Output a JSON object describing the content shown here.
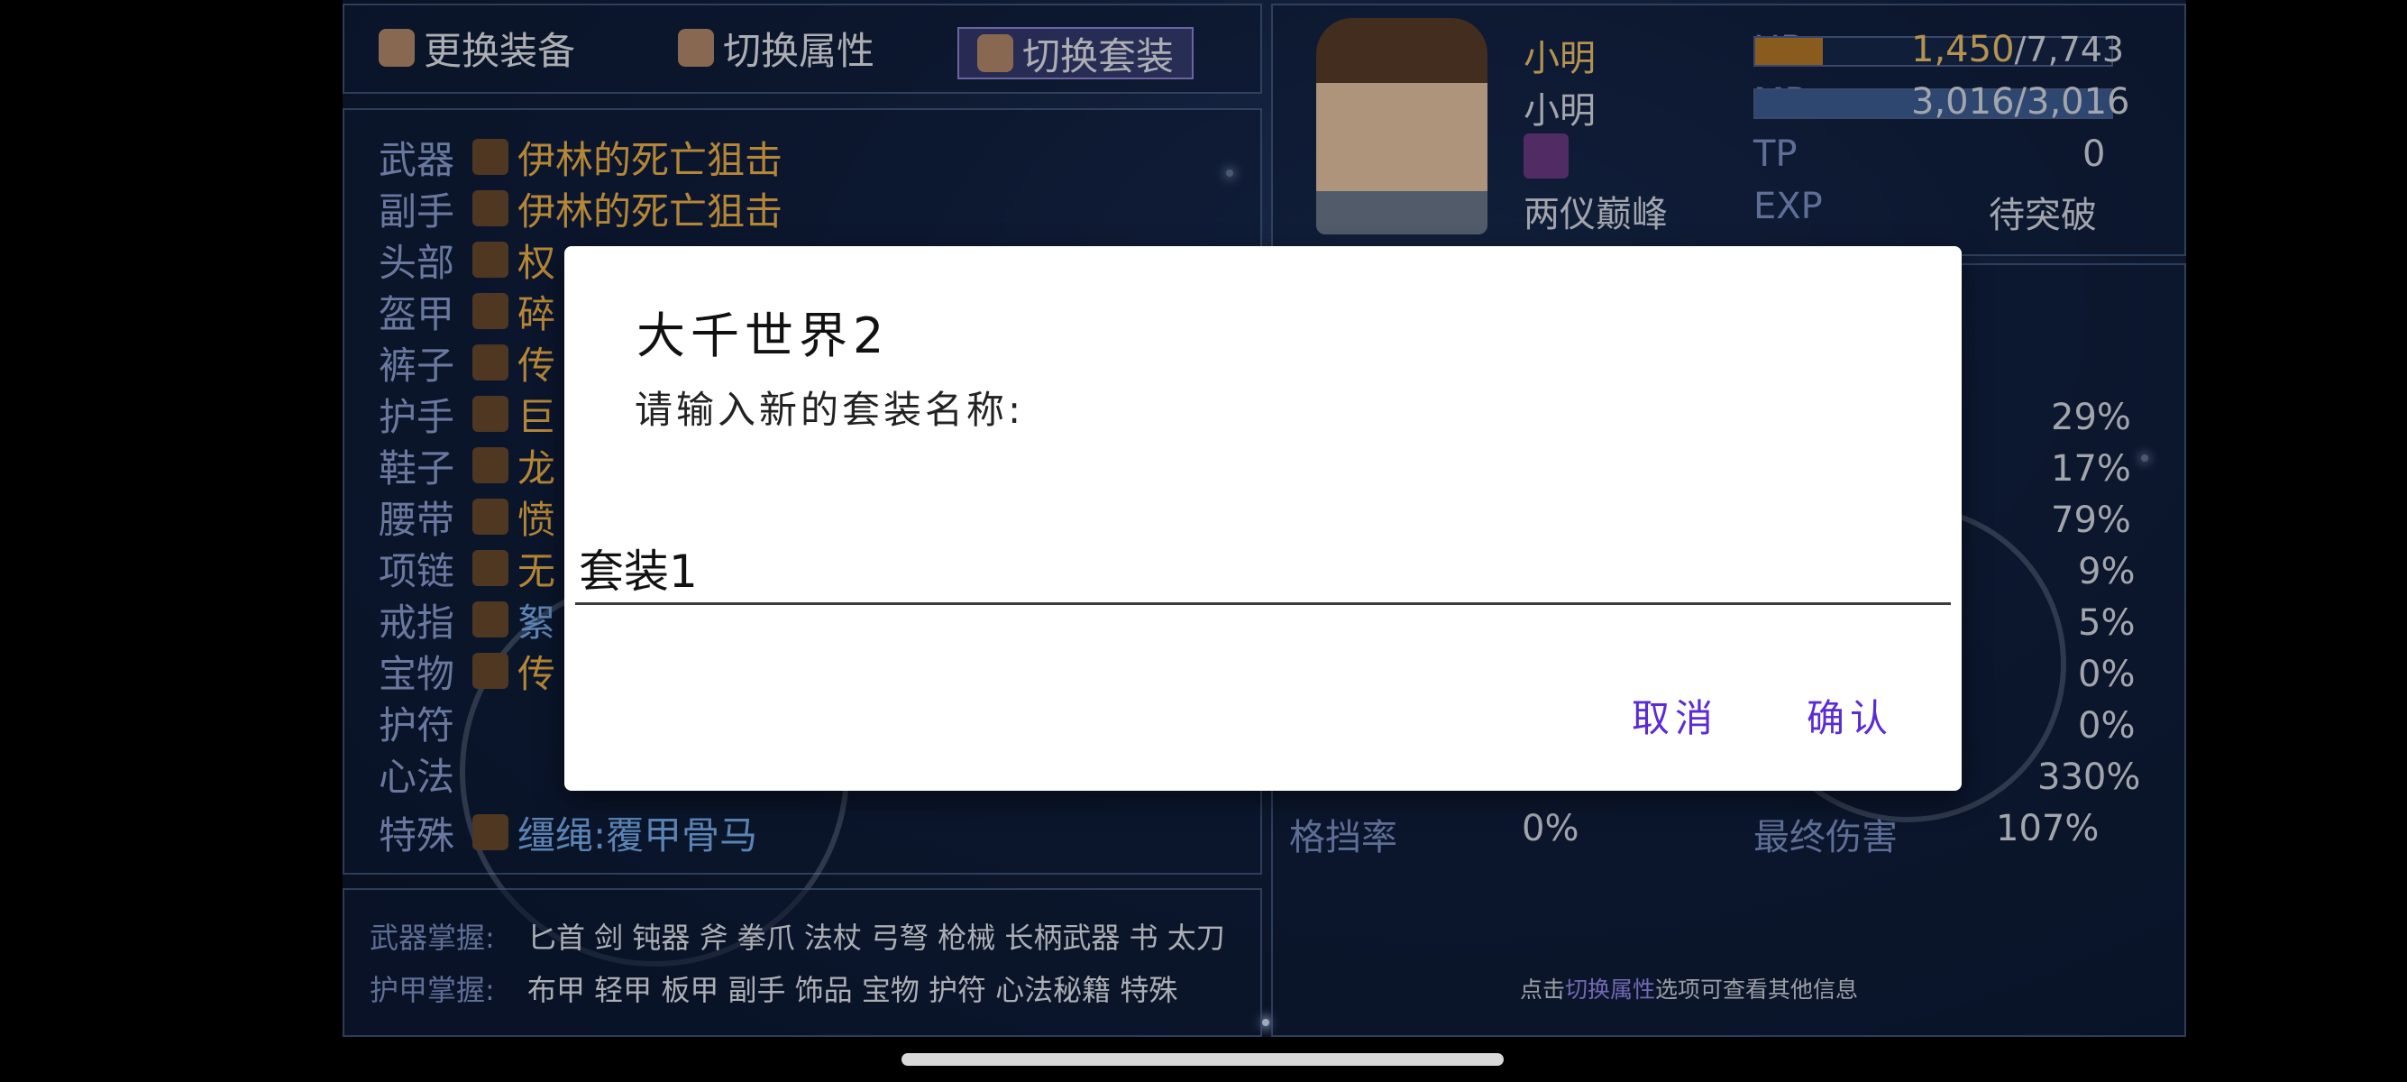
{
  "tabs": [
    {
      "label": "更换装备",
      "icon": "gear-swap-icon"
    },
    {
      "label": "切换属性",
      "icon": "armor-icon"
    },
    {
      "label": "切换套装",
      "icon": "armor-icon",
      "active": true
    }
  ],
  "equipment": [
    {
      "slot": "武器",
      "item": "伊林的死亡狙击"
    },
    {
      "slot": "副手",
      "item": "伊林的死亡狙击"
    },
    {
      "slot": "头部",
      "item": "权"
    },
    {
      "slot": "盔甲",
      "item": "碎"
    },
    {
      "slot": "裤子",
      "item": "传"
    },
    {
      "slot": "护手",
      "item": "巨"
    },
    {
      "slot": "鞋子",
      "item": "龙"
    },
    {
      "slot": "腰带",
      "item": "愤"
    },
    {
      "slot": "项链",
      "item": "无"
    },
    {
      "slot": "戒指",
      "item": "絮"
    },
    {
      "slot": "宝物",
      "item": "传"
    },
    {
      "slot": "护符",
      "item": ""
    },
    {
      "slot": "心法",
      "item": ""
    },
    {
      "slot": "特殊",
      "item": "缰绳:覆甲骨马"
    }
  ],
  "mastery": {
    "weapon_label": "武器掌握:",
    "weapon_value": "匕首 剑 钝器 斧 拳爪 法杖 弓弩 枪械 长柄武器 书 太刀",
    "armor_label": "护甲掌握:",
    "armor_value": "布甲 轻甲 板甲 副手 饰品 宝物 护符 心法秘籍 特殊"
  },
  "character": {
    "name1": "小明",
    "name2": "小明",
    "realm": "两仪巅峰",
    "hp_label": "HP",
    "hp_current": "1,450",
    "hp_max": "/7,743",
    "mp_label": "MP",
    "mp_value": "3,016/3,016",
    "tp_label": "TP",
    "tp_value": "0",
    "exp_label": "EXP",
    "exp_value": "待突破"
  },
  "stats": {
    "values": [
      "29%",
      "17%",
      "79%",
      "9%",
      "5%",
      "0%",
      "0%",
      "330%"
    ],
    "block_label": "格挡率",
    "block_value": "0%",
    "final_dmg_label": "最终伤害",
    "final_dmg_value": "107%",
    "hint_prefix": "点击",
    "hint_link": "切换属性",
    "hint_suffix": "选项可查看其他信息"
  },
  "dialog": {
    "title": "大千世界2",
    "message": "请输入新的套装名称:",
    "input_value": "套装1",
    "cancel_label": "取消",
    "confirm_label": "确认"
  },
  "colors": {
    "accent": "#5b2bd6",
    "gold": "#f1c36a",
    "label_blue": "#8ea0d4"
  }
}
